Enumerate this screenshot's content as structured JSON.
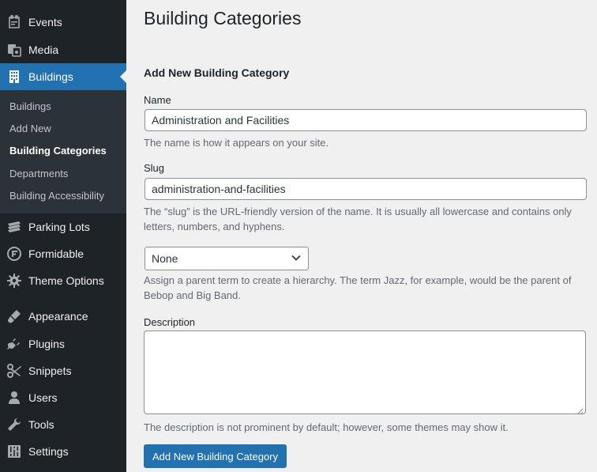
{
  "sidebar": {
    "items": [
      {
        "label": "Events",
        "icon": "calendar-icon"
      },
      {
        "label": "Media",
        "icon": "media-icon"
      },
      {
        "label": "Buildings",
        "icon": "building-icon",
        "current": true
      },
      {
        "label": "Parking Lots",
        "icon": "parking-lots-icon"
      },
      {
        "label": "Formidable",
        "icon": "formidable-icon"
      },
      {
        "label": "Theme Options",
        "icon": "gear-icon"
      },
      {
        "label": "Appearance",
        "icon": "paintbrush-icon"
      },
      {
        "label": "Plugins",
        "icon": "plugin-icon"
      },
      {
        "label": "Snippets",
        "icon": "scissors-icon"
      },
      {
        "label": "Users",
        "icon": "user-icon"
      },
      {
        "label": "Tools",
        "icon": "wrench-icon"
      },
      {
        "label": "Settings",
        "icon": "sliders-icon"
      }
    ],
    "submenu": [
      {
        "label": "Buildings"
      },
      {
        "label": "Add New"
      },
      {
        "label": "Building Categories",
        "current": true
      },
      {
        "label": "Departments"
      },
      {
        "label": "Building Accessibility"
      }
    ]
  },
  "page": {
    "title": "Building Categories",
    "form_heading": "Add New Building Category",
    "name": {
      "label": "Name",
      "value": "Administration and Facilities",
      "help": "The name is how it appears on your site."
    },
    "slug": {
      "label": "Slug",
      "value": "administration-and-facilities",
      "help": "The “slug” is the URL-friendly version of the name. It is usually all lowercase and contains only letters, numbers, and hyphens."
    },
    "parent": {
      "selected": "None",
      "help": "Assign a parent term to create a hierarchy. The term Jazz, for example, would be the parent of Bebop and Big Band."
    },
    "description": {
      "label": "Description",
      "value": "",
      "help": "The description is not prominent by default; however, some themes may show it."
    },
    "submit_label": "Add New Building Category"
  },
  "colors": {
    "sidebar_bg": "#1d2327",
    "submenu_bg": "#2c3338",
    "accent": "#2271b1",
    "page_bg": "#f0f0f1"
  }
}
